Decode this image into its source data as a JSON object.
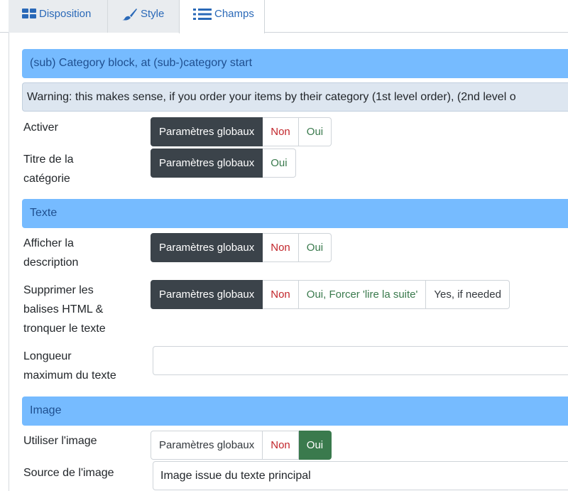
{
  "tabs": [
    {
      "label": "Disposition",
      "icon": "layout-grid-icon"
    },
    {
      "label": "Style",
      "icon": "brush-icon"
    },
    {
      "label": "Champs",
      "icon": "list-icon"
    }
  ],
  "sections": {
    "category": "(sub) Category block, at (sub-)category start",
    "text": "Texte",
    "image": "Image"
  },
  "warning": "Warning: this makes sense, if you order your items by their category (1st level order), (2nd level o",
  "fields": {
    "activate": {
      "label": "Activer",
      "options": [
        "Paramètres globaux",
        "Non",
        "Oui"
      ],
      "selected": "Paramètres globaux"
    },
    "category_title": {
      "label_line1": "Titre de la",
      "label_line2": "catégorie",
      "options": [
        "Paramètres globaux",
        "Oui"
      ],
      "selected": "Paramètres globaux"
    },
    "show_description": {
      "label_line1": "Afficher la",
      "label_line2": "description",
      "options": [
        "Paramètres globaux",
        "Non",
        "Oui"
      ],
      "selected": "Paramètres globaux"
    },
    "strip_html": {
      "label_line1": "Supprimer les",
      "label_line2": "balises HTML &",
      "label_line3": "tronquer le texte",
      "options": [
        "Paramètres globaux",
        "Non",
        "Oui, Forcer 'lire la suite'",
        "Yes, if needed"
      ],
      "selected": "Paramètres globaux"
    },
    "max_length": {
      "label_line1": "Longueur",
      "label_line2": "maximum du texte",
      "value": ""
    },
    "use_image": {
      "label": "Utiliser l'image",
      "options": [
        "Paramètres globaux",
        "Non",
        "Oui"
      ],
      "selected": "Oui"
    },
    "image_source": {
      "label": "Source de l'image",
      "value": "Image issue du texte principal"
    }
  },
  "colors": {
    "section_bg": "#76bbff",
    "active_dark": "#3b434a",
    "active_green": "#3a7a4d",
    "no_red": "#c2262b"
  }
}
